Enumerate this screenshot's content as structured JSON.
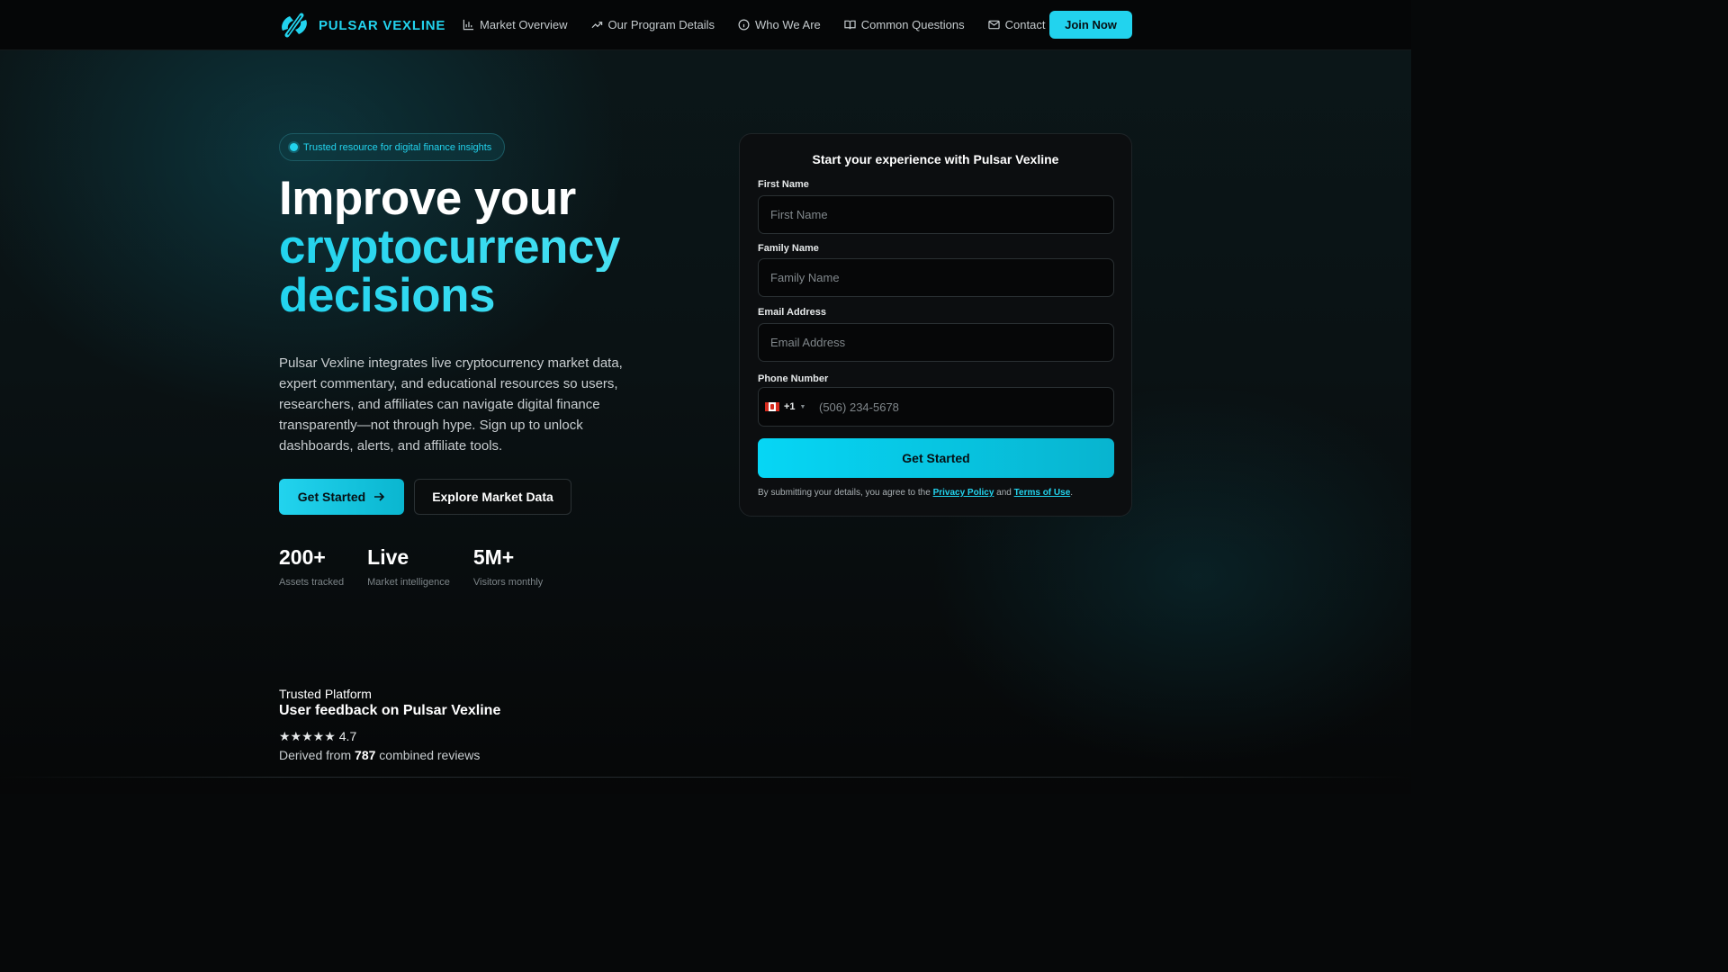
{
  "header": {
    "brand_name": "PULSAR VEXLINE",
    "nav": [
      {
        "label": "Market Overview",
        "icon": "bar-chart-icon"
      },
      {
        "label": "Our Program Details",
        "icon": "trending-up-icon"
      },
      {
        "label": "Who We Are",
        "icon": "info-icon"
      },
      {
        "label": "Common Questions",
        "icon": "book-open-icon"
      },
      {
        "label": "Contact Us",
        "icon": "mail-icon"
      }
    ],
    "join_label": "Join Now"
  },
  "hero": {
    "badge": "Trusted resource for digital finance insights",
    "title_line1": "Improve your",
    "title_line2": "cryptocurrency",
    "title_line3": "decisions",
    "description": "Pulsar Vexline integrates live cryptocurrency market data, expert commentary, and educational resources so users, researchers, and affiliates can navigate digital finance transparently—not through hype. Sign up to unlock dashboards, alerts, and affiliate tools.",
    "cta_primary": "Get Started",
    "cta_secondary": "Explore Market Data",
    "stats": [
      {
        "value": "200+",
        "label": "Assets tracked"
      },
      {
        "value": "Live",
        "label": "Market intelligence"
      },
      {
        "value": "5M+",
        "label": "Visitors monthly"
      }
    ]
  },
  "form": {
    "title": "Start your experience with Pulsar Vexline",
    "first_name_label": "First Name",
    "first_name_placeholder": "First Name",
    "family_name_label": "Family Name",
    "family_name_placeholder": "Family Name",
    "email_label": "Email Address",
    "email_placeholder": "Email Address",
    "phone_label": "Phone Number",
    "phone_country_code": "+1",
    "phone_placeholder": "(506) 234-5678",
    "submit_label": "Get Started",
    "consent_prefix": "By submitting your details, you agree to the",
    "privacy_link": "Privacy Policy",
    "consent_and": "and",
    "terms_link": "Terms of Use",
    "consent_suffix": "."
  },
  "trust": {
    "eyebrow": "Trusted Platform",
    "title": "User feedback on Pulsar Vexline",
    "stars": "★★★★★",
    "rating": "4.7",
    "reviews_prefix": "Derived from",
    "reviews_count": "787",
    "reviews_suffix": "combined reviews"
  },
  "colors": {
    "accent": "#22d3ee",
    "background": "#060809",
    "card": "#0c0e10"
  }
}
